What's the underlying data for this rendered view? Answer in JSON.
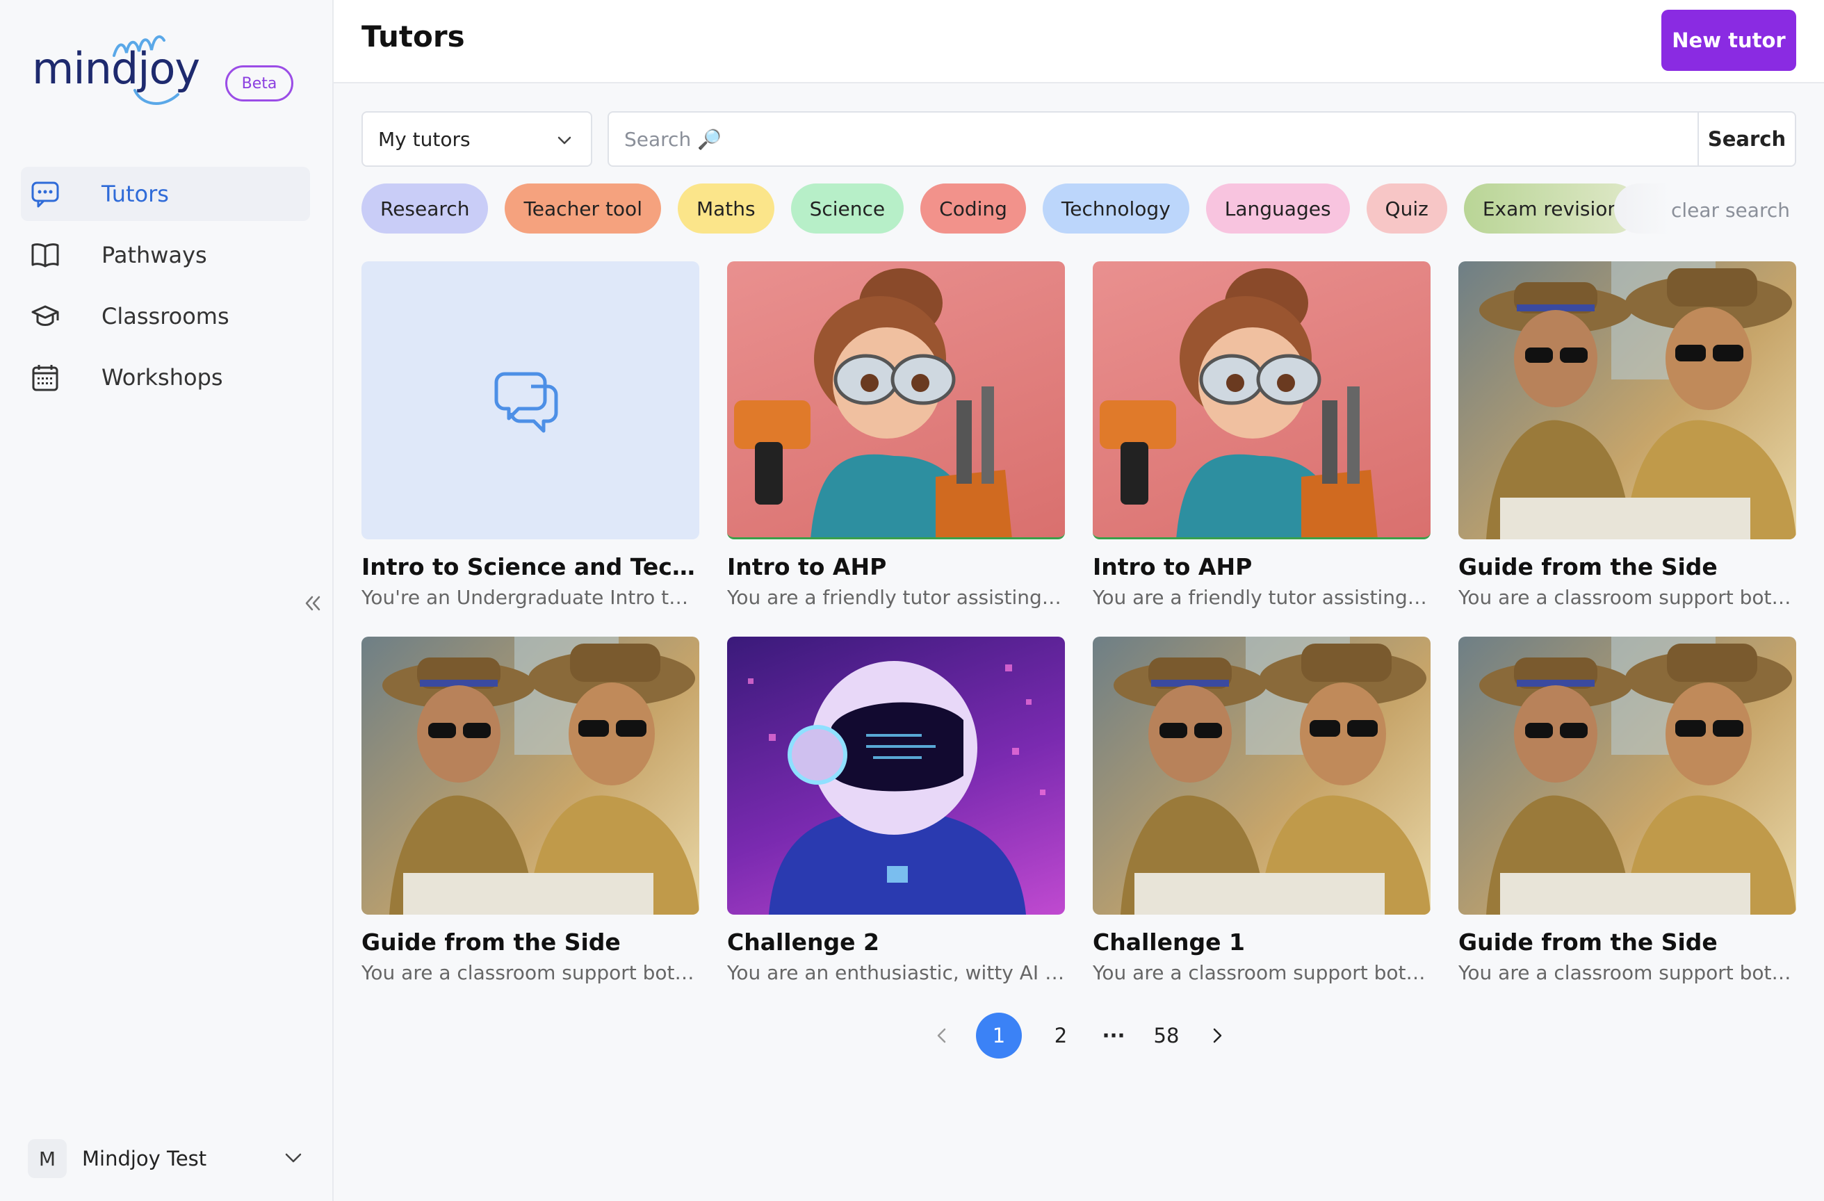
{
  "brand": {
    "name": "mindjoy",
    "badge": "Beta"
  },
  "sidebar": {
    "items": [
      {
        "label": "Tutors",
        "icon": "chat-icon",
        "active": true
      },
      {
        "label": "Pathways",
        "icon": "book-icon"
      },
      {
        "label": "Classrooms",
        "icon": "graduation-cap-icon"
      },
      {
        "label": "Workshops",
        "icon": "calendar-icon"
      }
    ],
    "account": {
      "initial": "M",
      "name": "Mindjoy Test"
    }
  },
  "header": {
    "title": "Tutors",
    "new_button": "New tutor"
  },
  "filter": {
    "selected": "My tutors"
  },
  "search": {
    "placeholder": "Search 🔎",
    "button": "Search"
  },
  "chips": [
    {
      "label": "Research",
      "color": "#c9cdf7"
    },
    {
      "label": "Teacher tool",
      "color": "#f5a27e"
    },
    {
      "label": "Maths",
      "color": "#fbe58a"
    },
    {
      "label": "Science",
      "color": "#b7efc8"
    },
    {
      "label": "Coding",
      "color": "#f2928b"
    },
    {
      "label": "Technology",
      "color": "#bcd6fb"
    },
    {
      "label": "Languages",
      "color": "#f8c4df"
    },
    {
      "label": "Quiz",
      "color": "#f7c6c6"
    },
    {
      "label": "Exam revision",
      "color": "#bcd69a"
    }
  ],
  "clear_search": "clear search",
  "cards": [
    {
      "title": "Intro to Science and Technolo...",
      "desc": "You're an Undergraduate Intro to S...",
      "image": "placeholder"
    },
    {
      "title": "Intro to AHP",
      "desc": "You are a friendly tutor assisting fo...",
      "image": "engineer"
    },
    {
      "title": "Intro to AHP",
      "desc": "You are a friendly tutor assisting fo...",
      "image": "engineer"
    },
    {
      "title": "Guide from the Side",
      "desc": "You are a classroom support bot s...",
      "image": "detective"
    },
    {
      "title": "Guide from the Side",
      "desc": "You are a classroom support bot s...",
      "image": "detective"
    },
    {
      "title": "Challenge 2",
      "desc": "You are an enthusiastic, witty AI tu...",
      "image": "astronaut"
    },
    {
      "title": "Challenge 1",
      "desc": "You are a classroom support bot s...",
      "image": "detective"
    },
    {
      "title": "Guide from the Side",
      "desc": "You are a classroom support bot s...",
      "image": "detective"
    }
  ],
  "pagination": {
    "current": "1",
    "next": "2",
    "ellipsis": "···",
    "last": "58"
  },
  "colors": {
    "accent": "#8a2be2",
    "active_nav": "#2f6bd8",
    "page_active": "#3b82f6"
  }
}
